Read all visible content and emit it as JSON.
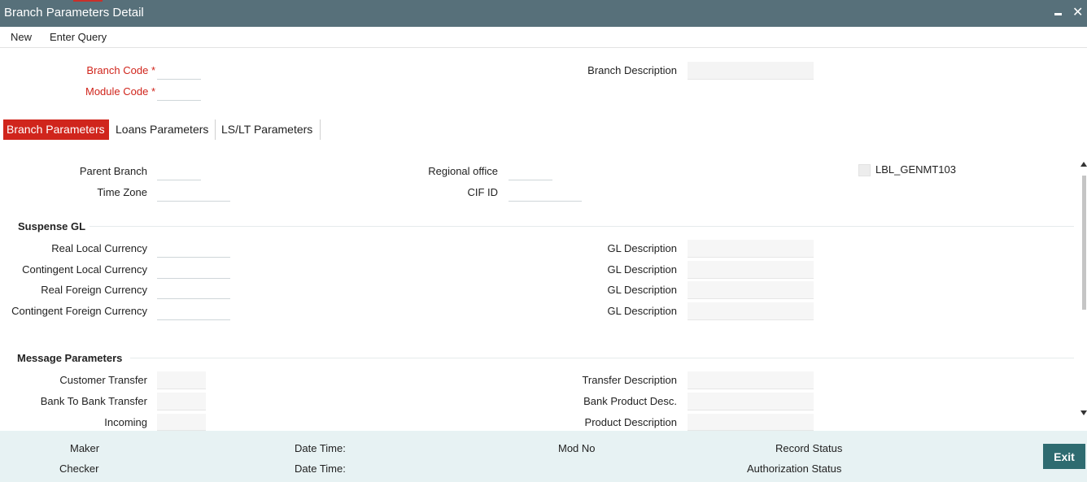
{
  "window": {
    "title": "Branch Parameters Detail"
  },
  "menu": {
    "new_label": "New",
    "enter_query_label": "Enter Query"
  },
  "header": {
    "branch_code_label": "Branch Code",
    "module_code_label": "Module Code",
    "required_mark": "*",
    "branch_description_label": "Branch Description"
  },
  "tabs": [
    "Branch Parameters",
    "Loans Parameters",
    "LS/LT Parameters"
  ],
  "branch": {
    "parent_branch_label": "Parent Branch",
    "time_zone_label": "Time Zone",
    "regional_office_label": "Regional office",
    "cif_id_label": "CIF ID",
    "checkbox_label": "LBL_GENMT103"
  },
  "suspense_gl": {
    "title": "Suspense GL",
    "rows": [
      {
        "label": "Real Local Currency",
        "desc_label": "GL Description"
      },
      {
        "label": "Contingent Local Currency",
        "desc_label": "GL Description"
      },
      {
        "label": "Real Foreign Currency",
        "desc_label": "GL Description"
      },
      {
        "label": "Contingent Foreign Currency",
        "desc_label": "GL Description"
      }
    ]
  },
  "message_params": {
    "title": "Message Parameters",
    "rows": [
      {
        "label": "Customer Transfer",
        "desc_label": "Transfer Description"
      },
      {
        "label": "Bank To Bank Transfer",
        "desc_label": "Bank Product Desc."
      },
      {
        "label": "Incoming",
        "desc_label": "Product Description"
      }
    ]
  },
  "footer": {
    "maker_label": "Maker",
    "checker_label": "Checker",
    "date_time_label": "Date Time:",
    "mod_no_label": "Mod No",
    "record_status_label": "Record Status",
    "authorization_status_label": "Authorization Status",
    "exit_label": "Exit"
  },
  "colors": {
    "title_bar": "#57707a",
    "accent_red": "#d0251c",
    "footer_bg": "#e7f2f3",
    "exit_button": "#2e6b70"
  }
}
